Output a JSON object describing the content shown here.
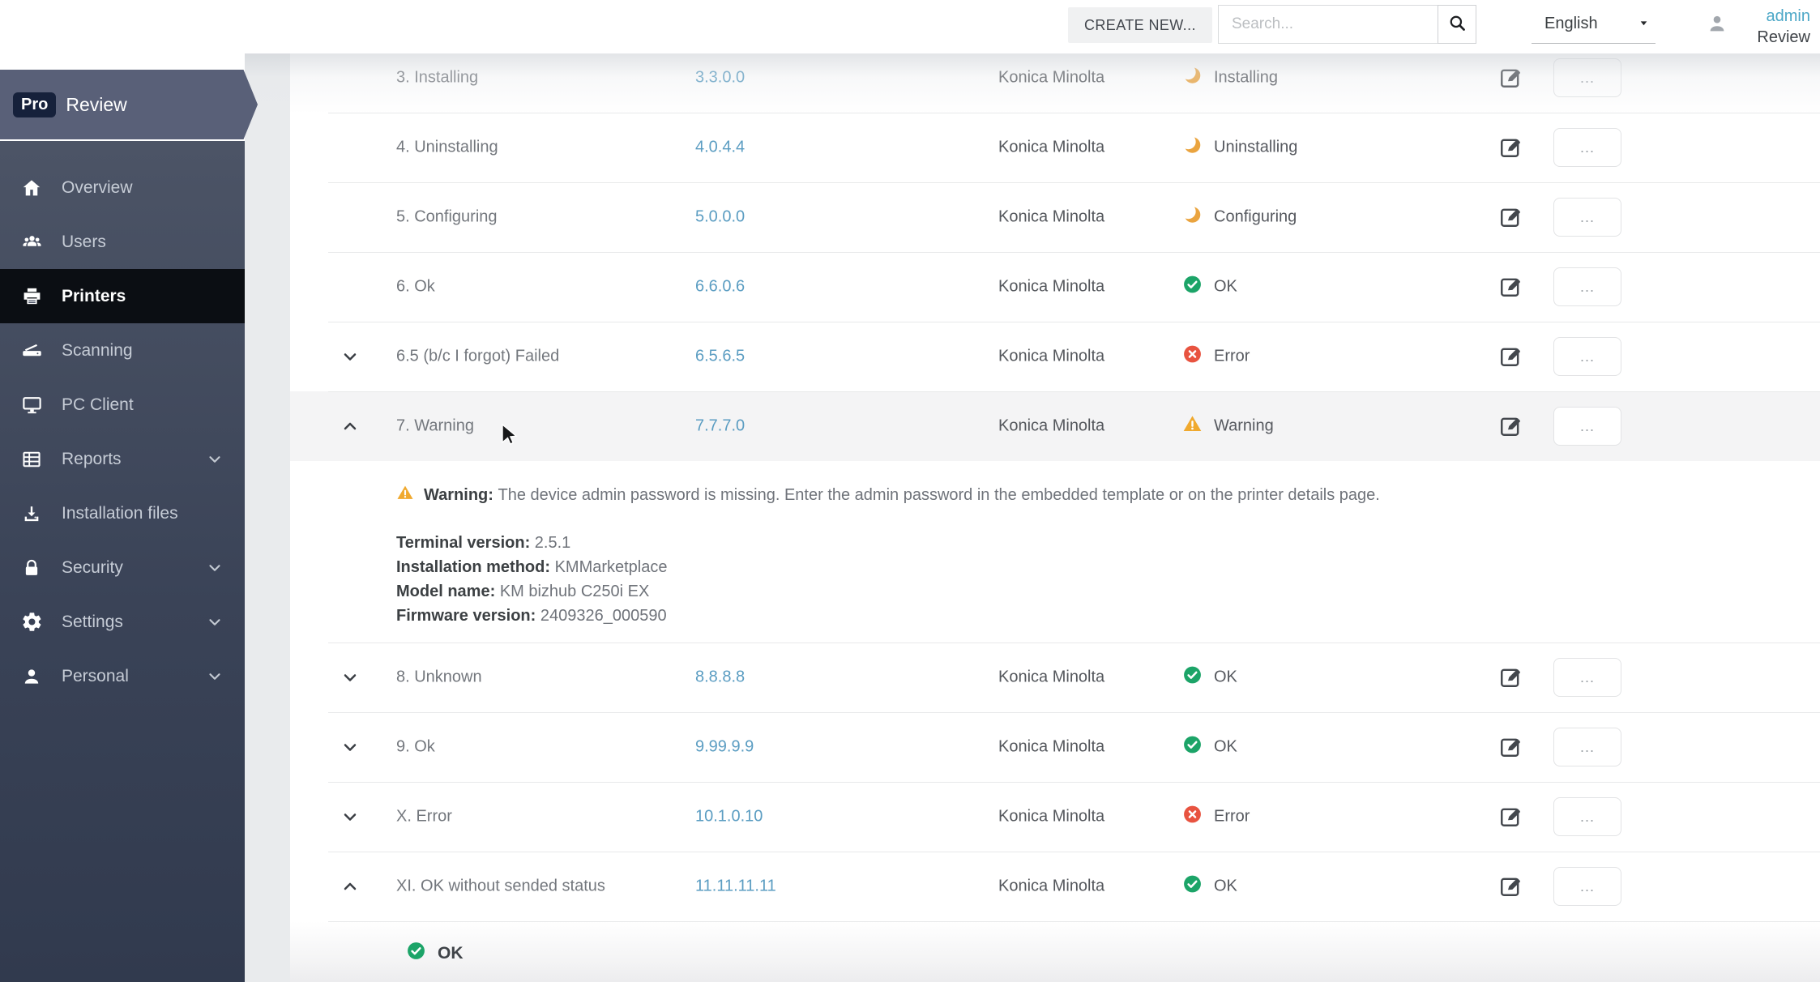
{
  "topbar": {
    "create_new_label": "CREATE NEW...",
    "search_placeholder": "Search...",
    "search_icon": "search-icon",
    "language": "English",
    "language_caret_icon": "caret-down-icon",
    "user_icon": "user-icon",
    "user_name": "admin",
    "user_role": "Review"
  },
  "sidebar": {
    "brand_badge": "Pro",
    "brand_name": "Review",
    "items": [
      {
        "label": "Overview",
        "icon": "home-icon",
        "active": false,
        "chevron": false
      },
      {
        "label": "Users",
        "icon": "users-icon",
        "active": false,
        "chevron": false
      },
      {
        "label": "Printers",
        "icon": "printer-icon",
        "active": true,
        "chevron": false
      },
      {
        "label": "Scanning",
        "icon": "scanner-icon",
        "active": false,
        "chevron": false
      },
      {
        "label": "PC Client",
        "icon": "monitor-icon",
        "active": false,
        "chevron": false
      },
      {
        "label": "Reports",
        "icon": "reports-table-icon",
        "active": false,
        "chevron": true
      },
      {
        "label": "Installation files",
        "icon": "download-icon",
        "active": false,
        "chevron": false
      },
      {
        "label": "Security",
        "icon": "lock-icon",
        "active": false,
        "chevron": true
      },
      {
        "label": "Settings",
        "icon": "gear-icon",
        "active": false,
        "chevron": true
      },
      {
        "label": "Personal",
        "icon": "person-icon",
        "active": false,
        "chevron": true
      }
    ]
  },
  "table": {
    "rows": [
      {
        "name": "3. Installing",
        "version": "3.3.0.0",
        "vendor": "Konica Minolta",
        "status": "Installing",
        "status_icon": "moon-progress-icon",
        "expander": null,
        "highlighted": false
      },
      {
        "name": "4. Uninstalling",
        "version": "4.0.4.4",
        "vendor": "Konica Minolta",
        "status": "Uninstalling",
        "status_icon": "moon-progress-icon",
        "expander": null,
        "highlighted": false
      },
      {
        "name": "5. Configuring",
        "version": "5.0.0.0",
        "vendor": "Konica Minolta",
        "status": "Configuring",
        "status_icon": "moon-progress-icon",
        "expander": null,
        "highlighted": false
      },
      {
        "name": "6. Ok",
        "version": "6.6.0.6",
        "vendor": "Konica Minolta",
        "status": "OK",
        "status_icon": "check-circle-icon",
        "expander": null,
        "highlighted": false
      },
      {
        "name": "6.5 (b/c I forgot) Failed",
        "version": "6.5.6.5",
        "vendor": "Konica Minolta",
        "status": "Error",
        "status_icon": "x-circle-icon",
        "expander": "down",
        "highlighted": false
      },
      {
        "name": "7. Warning",
        "version": "7.7.7.0",
        "vendor": "Konica Minolta",
        "status": "Warning",
        "status_icon": "warning-triangle-icon",
        "expander": "up",
        "highlighted": true
      },
      {
        "name": "8. Unknown",
        "version": "8.8.8.8",
        "vendor": "Konica Minolta",
        "status": "OK",
        "status_icon": "check-circle-icon",
        "expander": "down",
        "highlighted": false
      },
      {
        "name": "9. Ok",
        "version": "9.99.9.9",
        "vendor": "Konica Minolta",
        "status": "OK",
        "status_icon": "check-circle-icon",
        "expander": "down",
        "highlighted": false
      },
      {
        "name": "X. Error",
        "version": "10.1.0.10",
        "vendor": "Konica Minolta",
        "status": "Error",
        "status_icon": "x-circle-icon",
        "expander": "down",
        "highlighted": false
      },
      {
        "name": "XI. OK without sended status",
        "version": "11.11.11.11",
        "vendor": "Konica Minolta",
        "status": "OK",
        "status_icon": "check-circle-icon",
        "expander": "up",
        "highlighted": false
      }
    ],
    "row_more_label": "...",
    "warning_detail": {
      "after_row": "7. Warning",
      "icon": "warning-triangle-icon",
      "warning_label": "Warning:",
      "warning_text": "The device admin password is missing. Enter the admin password in the embedded template or on the printer details page.",
      "fields": [
        {
          "label": "Terminal version:",
          "value": "2.5.1"
        },
        {
          "label": "Installation method:",
          "value": "KMMarketplace"
        },
        {
          "label": "Model name:",
          "value": "KM bizhub C250i EX"
        },
        {
          "label": "Firmware version:",
          "value": "2409326_000590"
        }
      ]
    },
    "ok_detail": {
      "after_row": "XI. OK without sended status",
      "icon": "check-circle-icon",
      "label": "OK"
    }
  },
  "colors": {
    "version_link": "#5b9dc2",
    "status_ok": "#1ca468",
    "status_error": "#e85340",
    "status_warning": "#f0a92e",
    "status_progress": "#eaa43f",
    "sidebar_active_bg": "#0b0e13",
    "admin_link": "#4ba7c7"
  }
}
